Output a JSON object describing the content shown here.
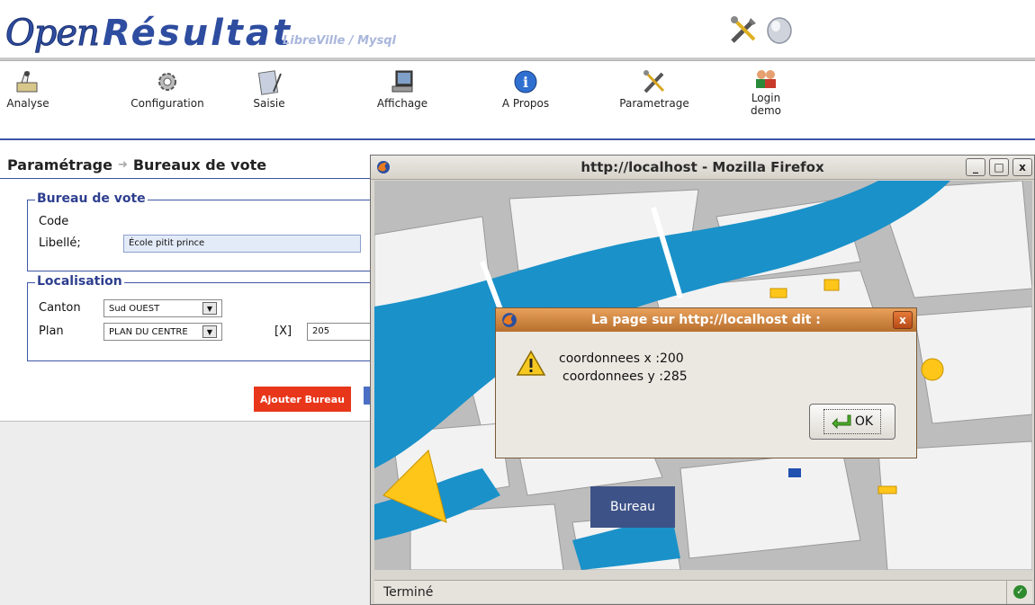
{
  "app": {
    "logo_open": "Open",
    "logo_resultat": "Résultat",
    "subtitle": "LibreVille / Mysql"
  },
  "menu": {
    "items": [
      {
        "label": "Analyse",
        "icon": "analyse-icon"
      },
      {
        "label": "Configuration",
        "icon": "gear-icon"
      },
      {
        "label": "Saisie",
        "icon": "notepad-icon"
      },
      {
        "label": "Affichage",
        "icon": "monitor-icon"
      },
      {
        "label": "A Propos",
        "icon": "info-icon"
      },
      {
        "label": "Parametrage",
        "icon": "tools-icon"
      },
      {
        "label": "Login\ndemo",
        "icon": "users-icon"
      }
    ]
  },
  "page": {
    "breadcrumb_1": "Paramétrage",
    "breadcrumb_2": "Bureaux de vote",
    "section_bureau": "Bureau de vote",
    "code_label": "Code",
    "libelle_label": "Libellé;",
    "libelle_value": "École pitit prince",
    "section_localisation": "Localisation",
    "canton_label": "Canton",
    "canton_value": "Sud OUEST",
    "plan_label": "Plan",
    "plan_value": "PLAN DU CENTRE",
    "x_label": "[X]",
    "x_value": "205",
    "add_button": "Ajouter Bureau"
  },
  "firefox": {
    "title": "http://localhost - Mozilla Firefox",
    "minimize": "_",
    "maximize": "□",
    "close": "x",
    "bureau_label": "Bureau",
    "status": "Terminé"
  },
  "dialog": {
    "title": "La page sur http://localhost dit :",
    "line1": "coordonnees x :200",
    "line2": "coordonnees y :285",
    "ok": "OK",
    "close": "x"
  },
  "colors": {
    "brand_blue": "#2e4da0",
    "accent_red": "#e8361a",
    "dialog_orange": "#c97c3a",
    "map_water": "#1a91c9",
    "map_block": "#f0f0f0"
  }
}
